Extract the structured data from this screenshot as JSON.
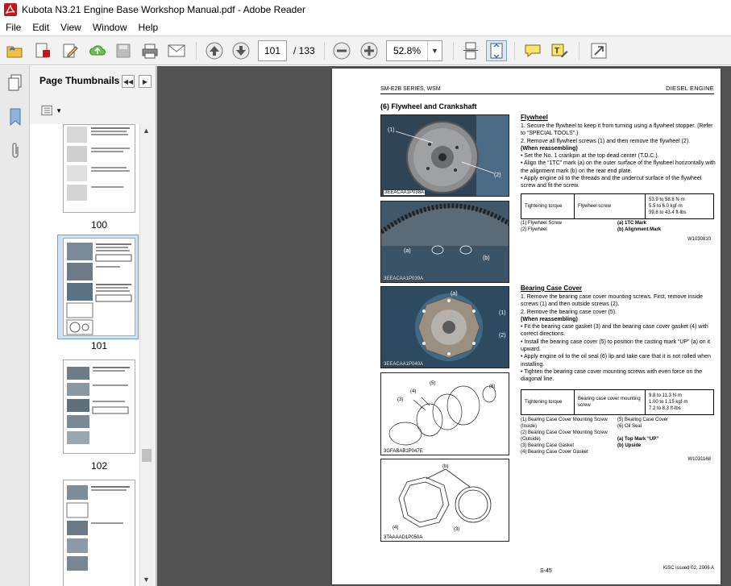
{
  "window": {
    "title": "Kubota N3.21 Engine Base Workshop Manual.pdf - Adobe Reader"
  },
  "menu": [
    "File",
    "Edit",
    "View",
    "Window",
    "Help"
  ],
  "toolbar": {
    "page_current": "101",
    "page_total": "/ 133",
    "zoom": "52.8%"
  },
  "thumbnails": {
    "header": "Page Thumbnails",
    "pages": [
      {
        "label": "100",
        "selected": false
      },
      {
        "label": "101",
        "selected": true
      },
      {
        "label": "102",
        "selected": false
      }
    ]
  },
  "document": {
    "header_left": "SM-E2B  SERIES, WSM",
    "header_right": "DIESEL  ENGINE",
    "section_title": "(6)  Flywheel and Crankshaft",
    "figures": [
      {
        "caption": "3EEACAA1P038A"
      },
      {
        "caption": "3EEACAA1P039A"
      },
      {
        "caption": "3EEACAA1P040A"
      },
      {
        "caption": "3GFABAB1P047E"
      },
      {
        "caption": "3TAAAAD1P050A"
      }
    ],
    "flywheel": {
      "heading": "Flywheel",
      "steps": [
        "1.  Secure the flywheel to keep it from turning using a flywheel stopper.  (Refer to “SPECIAL  TOOLS”.)",
        "2.  Remove all flywheel screws (1) and then remove the flywheel (2)."
      ],
      "reassembling_label": "(When reassembling)",
      "notes": [
        "•  Set the No. 1  crankpin at the top dead center (T.D.C.).",
        "•  Align the “1TC” mark (a) on the outer surface of the flywheel horizontally with the alignment mark (b) on the rear end plate.",
        "•  Apply engine oil to the threads and the undercut surface of the flywheel screw and fit the screw."
      ],
      "torque": {
        "label": "Tightening torque",
        "item": "Flywheel screw",
        "values": [
          "53.9 to 58.8 N·m",
          "5.5 to 6.0 kgf·m",
          "39.8 to 43.4 ft-lbs"
        ]
      },
      "legend_left": [
        "(1)  Flywheel Screw",
        "(2)  Flywheel"
      ],
      "legend_right": [
        "(a)  1TC Mark",
        "(b)  Alignment Mark"
      ],
      "code": "W1030810"
    },
    "bearing": {
      "heading": "Bearing Case Cover",
      "steps": [
        "1.  Remove the bearing case cover mounting screws.  First, remove inside screws (1) and then outside screws (2).",
        "2.  Remove the bearing case cover (5)."
      ],
      "reassembling_label": "(When reassembling)",
      "notes": [
        "•  Fit the bearing case gasket (3) and the bearing case cover gasket (4) with correct directions.",
        "•  Install the bearing case cover (5) to position the casting mark “UP” (a) on it upward.",
        "•  Apply engine oil to the oil seal (6) lip and take care that it is not rolled when installing.",
        "•  Tighten the bearing case cover mounting screws with even force on the diagonal line."
      ],
      "torque": {
        "label": "Tightening torque",
        "item": "Bearing case cover mounting screw",
        "values": [
          "9.8 to 11.3 N·m",
          "1.00 to 1.15 kgf·m",
          "7.2 to 8.3 ft-lbs"
        ]
      },
      "legend_left": [
        "(1)  Bearing Case Cover Mounting Screw",
        "       (Inside)",
        "(2)  Bearing Case Cover Mounting Screw",
        "       (Outside)",
        "(3)  Bearing Case Gasket",
        "(4)  Bearing Case Cover Gasket"
      ],
      "legend_right": [
        "(5)  Bearing Case Cover",
        "(6)  Oil Seal",
        "",
        "(a)  Top Mark “UP”",
        "(b)  Upside"
      ],
      "code": "W1031168"
    },
    "footer_center": "S-45",
    "footer_right": "KiSC issued 02, 2006 A"
  },
  "colors": {
    "doc_background": "#535353",
    "panel_background": "#f2f2f2",
    "selection": "#cfe1f5"
  }
}
